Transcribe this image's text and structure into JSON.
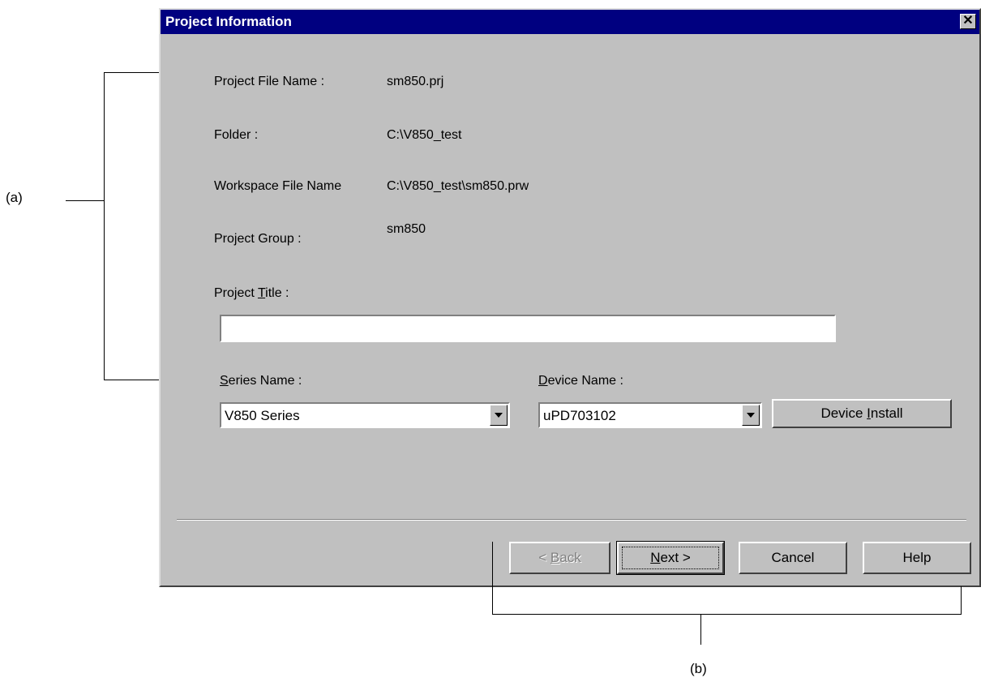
{
  "dialog": {
    "title": "Project Information",
    "close_label": "✕"
  },
  "fields": {
    "project_file_name": {
      "label": "Project File Name :",
      "value": "sm850.prj"
    },
    "folder": {
      "label": "Folder :",
      "value": "C:\\V850_test"
    },
    "workspace_file_name": {
      "label": "Workspace File Name",
      "value": "C:\\V850_test\\sm850.prw"
    },
    "project_group": {
      "label": "Project Group :",
      "value": "sm850"
    },
    "project_title": {
      "label_pre": "Project ",
      "label_mnemonic": "T",
      "label_post": "itle :",
      "value": ""
    }
  },
  "series": {
    "label_mnemonic": "S",
    "label_post": "eries Name :",
    "selected": "V850 Series"
  },
  "device": {
    "label_mnemonic": "D",
    "label_post": "evice Name :",
    "selected": "uPD703102"
  },
  "buttons": {
    "device_install": {
      "pre": "Device ",
      "mnemonic": "I",
      "post": "nstall"
    },
    "back": {
      "pre": "< ",
      "mnemonic": "B",
      "post": "ack"
    },
    "next": {
      "mnemonic": "N",
      "post": "ext >"
    },
    "cancel": "Cancel",
    "help": "Help"
  },
  "annotations": {
    "a": "(a)",
    "b": "(b)"
  }
}
